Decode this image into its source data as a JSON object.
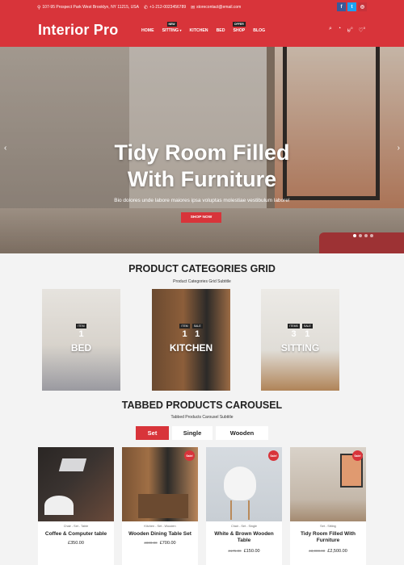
{
  "topbar": {
    "address": "107-95 Prospect Park West Brooklyn, NY 11215, USA",
    "phone": "+1-212-0023456789",
    "email": "storecontact@email.com",
    "social": [
      "facebook-icon",
      "twitter-icon",
      "instagram-icon"
    ]
  },
  "header": {
    "logo": "Interior Pro",
    "nav": [
      {
        "label": "HOME",
        "tag": ""
      },
      {
        "label": "SITTING",
        "tag": "NEW"
      },
      {
        "label": "KITCHEN",
        "tag": ""
      },
      {
        "label": "BED",
        "tag": ""
      },
      {
        "label": "SHOP",
        "tag": "OFFER"
      },
      {
        "label": "BLOG",
        "tag": ""
      }
    ],
    "icons": [
      "search-icon",
      "user-icon",
      "cart-icon",
      "wishlist-icon"
    ],
    "cart_count": "0",
    "wishlist_count": "0"
  },
  "hero": {
    "title_line1": "Tidy Room Filled",
    "title_line2": "With Furniture",
    "subtitle": "Bio dolores unde labore maiores ipsa voluptas molestiae vestibulum labore!",
    "button": "SHOP NOW",
    "slides": 4,
    "active_slide": 1
  },
  "categories_section": {
    "title": "PRODUCT CATEGORIES GRID",
    "subtitle": "Product Categories Grid Subtitle",
    "items": [
      {
        "name": "BED",
        "badges": [
          {
            "label": "ITEM",
            "count": "1"
          }
        ]
      },
      {
        "name": "KITCHEN",
        "badges": [
          {
            "label": "ITEM",
            "count": "1"
          },
          {
            "label": "SALE",
            "count": "1"
          }
        ]
      },
      {
        "name": "SITTING",
        "badges": [
          {
            "label": "ITEMS",
            "count": "3"
          },
          {
            "label": "SALE",
            "count": "1"
          }
        ]
      }
    ]
  },
  "carousel_section": {
    "title": "TABBED PRODUCTS CAROUSEL",
    "subtitle": "Tabbed Products Carousel Subtitle",
    "tabs": [
      "Set",
      "Single",
      "Wooden"
    ],
    "active_tab": "Set",
    "products": [
      {
        "meta": "Chair - Set - Table",
        "name": "Coffee & Computer table",
        "old_price": "",
        "price": "£350.00",
        "sale": false
      },
      {
        "meta": "Kitchen - Set - Wooden",
        "name": "Wooden Dining Table Set",
        "old_price": "£800.00",
        "price": "£700.00",
        "sale": true
      },
      {
        "meta": "Chair - Set - Single",
        "name": "White & Brown Wooden Table",
        "old_price": "£175.00",
        "price": "£150.00",
        "sale": true
      },
      {
        "meta": "Set - Sitting",
        "name": "Tidy Room Filled With Furniture",
        "old_price": "£3,000.00",
        "price": "£2,500.00",
        "sale": true
      }
    ],
    "sale_label": "Sale!"
  }
}
